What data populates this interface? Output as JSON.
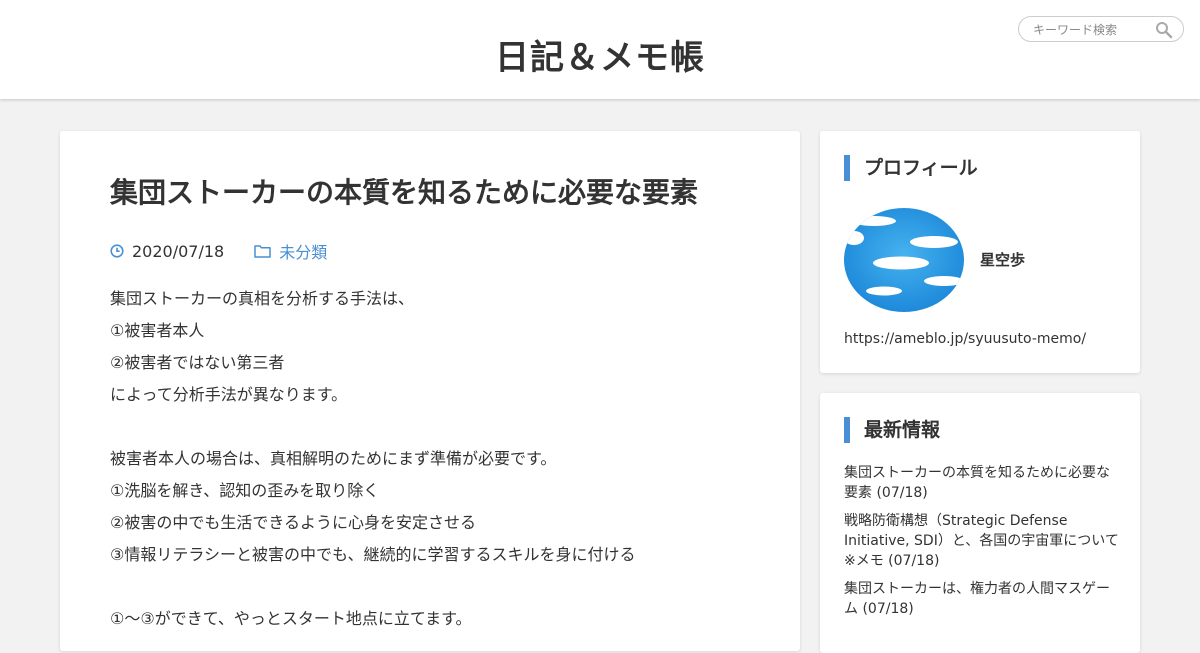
{
  "site": {
    "title": "日記＆メモ帳"
  },
  "search": {
    "placeholder": "キーワード検索"
  },
  "article": {
    "title": "集団ストーカーの本質を知るために必要な要素",
    "date": "2020/07/18",
    "category": "未分類",
    "lines": [
      "集団ストーカーの真相を分析する手法は、",
      "①被害者本人",
      "②被害者ではない第三者",
      "によって分析手法が異なります。",
      "",
      "被害者本人の場合は、真相解明のためにまず準備が必要です。",
      "①洗脳を解き、認知の歪みを取り除く",
      "②被害の中でも生活できるように心身を安定させる",
      "③情報リテラシーと被害の中でも、継続的に学習するスキルを身に付ける",
      "",
      "①～③ができて、やっとスタート地点に立てます。"
    ]
  },
  "profile": {
    "heading": "プロフィール",
    "name": "星空歩",
    "url": "https://ameblo.jp/syuusuto-memo/"
  },
  "latest": {
    "heading": "最新情報",
    "items": [
      "集団ストーカーの本質を知るために必要な要素 (07/18)",
      "戦略防衛構想（Strategic Defense Initiative, SDI）と、各国の宇宙軍について　※メモ (07/18)",
      "集団ストーカーは、権力者の人間マスゲーム (07/18)"
    ]
  },
  "icons": {
    "search": "search-icon",
    "date": "clock-icon",
    "category": "folder-icon"
  },
  "colors": {
    "accent": "#4a8fd6",
    "background": "#f2f2f2",
    "text": "#333333"
  }
}
